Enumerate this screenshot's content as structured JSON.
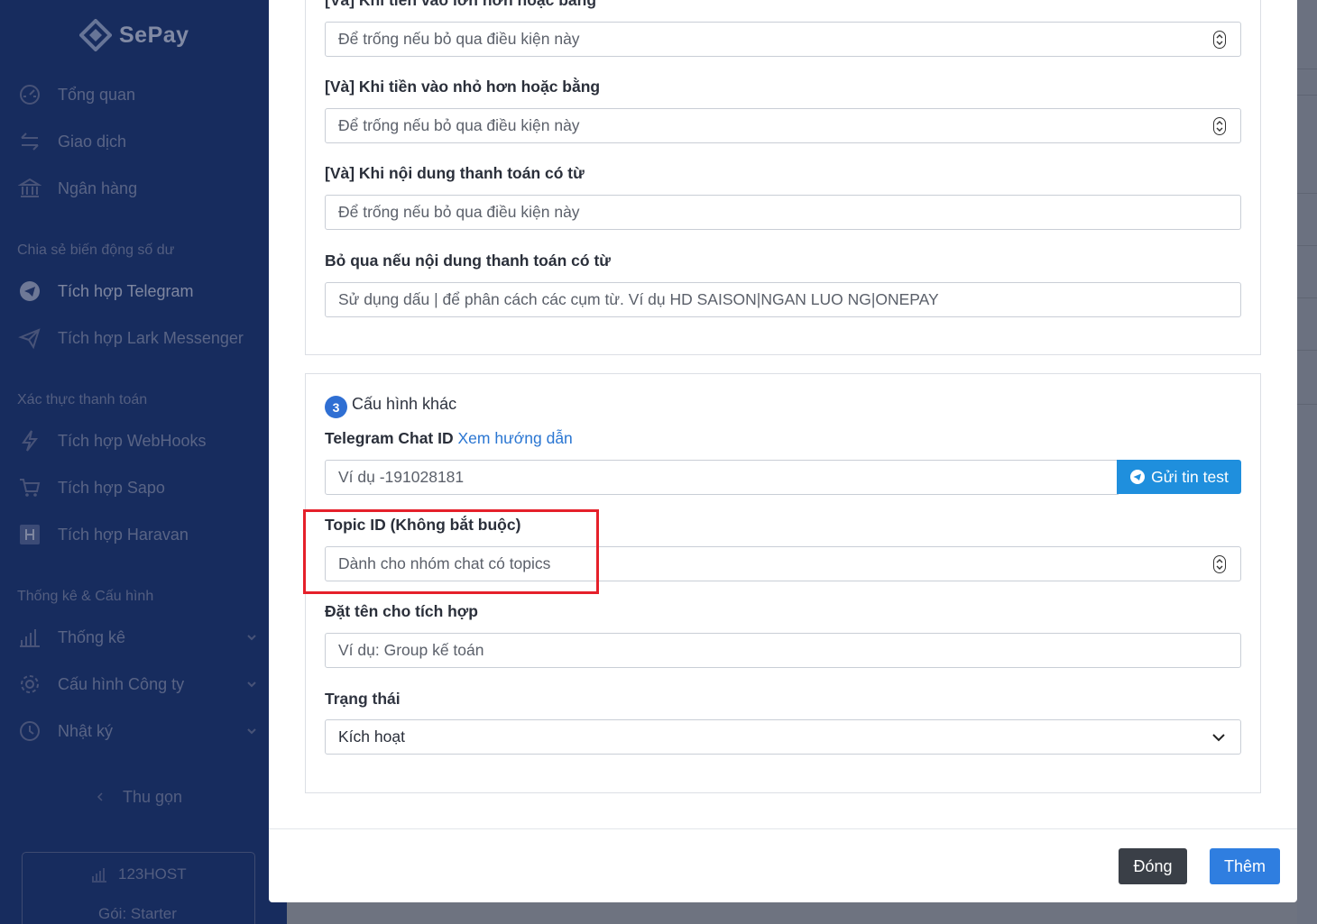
{
  "sidebar": {
    "brand": "SePay",
    "items_main": [
      {
        "label": "Tổng quan",
        "icon": "dashboard-icon"
      },
      {
        "label": "Giao dịch",
        "icon": "transfer-icon"
      },
      {
        "label": "Ngân hàng",
        "icon": "bank-icon"
      }
    ],
    "section_share": "Chia sẻ biến động số dư",
    "items_share": [
      {
        "label": "Tích hợp Telegram",
        "icon": "telegram-icon"
      },
      {
        "label": "Tích hợp Lark Messenger",
        "icon": "send-icon"
      }
    ],
    "section_verify": "Xác thực thanh toán",
    "items_verify": [
      {
        "label": "Tích hợp WebHooks",
        "icon": "lightning-icon"
      },
      {
        "label": "Tích hợp Sapo",
        "icon": "cart-icon"
      },
      {
        "label": "Tích hợp Haravan",
        "icon": "haravan-icon"
      }
    ],
    "section_stats": "Thống kê & Cấu hình",
    "items_stats": [
      {
        "label": "Thống kê",
        "icon": "bar-chart-icon"
      },
      {
        "label": "Cấu hình Công ty",
        "icon": "gear-icon"
      },
      {
        "label": "Nhật ký",
        "icon": "clock-icon"
      }
    ],
    "collapse": "Thu gọn",
    "account": {
      "company": "123HOST",
      "plan": "Gói: Starter"
    }
  },
  "form": {
    "amount_min_label": "[Và] Khi tiền vào lớn hơn hoặc bằng",
    "amount_min_placeholder": "Để trống nếu bỏ qua điều kiện này",
    "amount_max_label": "[Và] Khi tiền vào nhỏ hơn hoặc bằng",
    "amount_max_placeholder": "Để trống nếu bỏ qua điều kiện này",
    "content_has_label": "[Và] Khi nội dung thanh toán có từ",
    "content_has_placeholder": "Để trống nếu bỏ qua điều kiện này",
    "ignore_label": "Bỏ qua nếu nội dung thanh toán có từ",
    "ignore_placeholder": "Sử dụng dấu | để phân cách các cụm từ. Ví dụ HD SAISON|NGAN LUO NG|ONEPAY",
    "section3_number": "3",
    "section3_title": "Cấu hình khác",
    "chat_id_label": "Telegram Chat ID",
    "chat_id_guide": "Xem hướng dẫn",
    "chat_id_placeholder": "Ví dụ -191028181",
    "test_button": "Gửi tin test",
    "topic_label": "Topic ID (Không bắt buộc)",
    "topic_placeholder": "Dành cho nhóm chat có topics",
    "name_label": "Đặt tên cho tích hợp",
    "name_placeholder": "Ví dụ: Group kế toán",
    "status_label": "Trạng thái",
    "status_value": "Kích hoạt"
  },
  "footer": {
    "close_button": "Đóng",
    "add_button": "Thêm"
  },
  "colors": {
    "sidebar_bg": "#1e3a7a",
    "primary": "#2f7ee0",
    "info": "#1f8fdd",
    "dark": "#3a3f47",
    "highlight": "#e5202a"
  }
}
